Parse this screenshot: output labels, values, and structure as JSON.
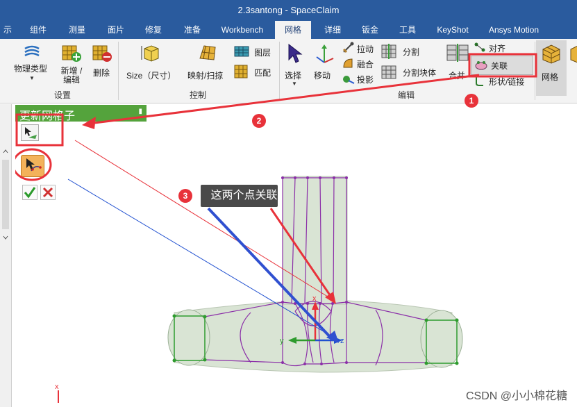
{
  "window": {
    "title": "2.3santong - SpaceClaim"
  },
  "menu": {
    "tabs": [
      {
        "label": "示"
      },
      {
        "label": "组件"
      },
      {
        "label": "测量"
      },
      {
        "label": "面片"
      },
      {
        "label": "修复"
      },
      {
        "label": "准备"
      },
      {
        "label": "Workbench"
      },
      {
        "label": "网格"
      },
      {
        "label": "详细"
      },
      {
        "label": "钣金"
      },
      {
        "label": "工具"
      },
      {
        "label": "KeyShot"
      },
      {
        "label": "Ansys Motion"
      }
    ],
    "active_tab": "网格"
  },
  "ribbon": {
    "setup": {
      "group_label": "设置",
      "physics_type": "物理类型",
      "add_edit": "新增 / 编辑",
      "delete": "删除"
    },
    "control": {
      "group_label": "控制",
      "size": "Size（尺寸）",
      "map_sweep": "映射/扫掠",
      "layer": "图层",
      "match": "匹配"
    },
    "edit": {
      "group_label": "编辑",
      "select": "选择",
      "move": "移动",
      "pull": "拉动",
      "blend": "融合",
      "project": "投影",
      "split": "分割",
      "split_body": "分割块体",
      "merge": "合并",
      "align": "对齐",
      "associate": "关联",
      "shape_link": "形状/链接"
    },
    "mesh": {
      "label": "网格"
    }
  },
  "tool_panel": {
    "title": "更新网格子"
  },
  "annotations": {
    "callout_text": "这两个点关联",
    "badges": [
      "1",
      "2",
      "3"
    ]
  },
  "watermark": "CSDN @小小棉花糖",
  "colors": {
    "title_bar": "#2a5b9e",
    "ribbon_bg": "#f3f3f3",
    "panel_header": "#54a33c",
    "highlight": "#e8323a",
    "mesh_edge": "#8b2fa8",
    "mesh_face": "#d9e4d4",
    "axis_x": "#e8323a",
    "axis_y": "#2e9b2e",
    "axis_z": "#2050d0"
  }
}
